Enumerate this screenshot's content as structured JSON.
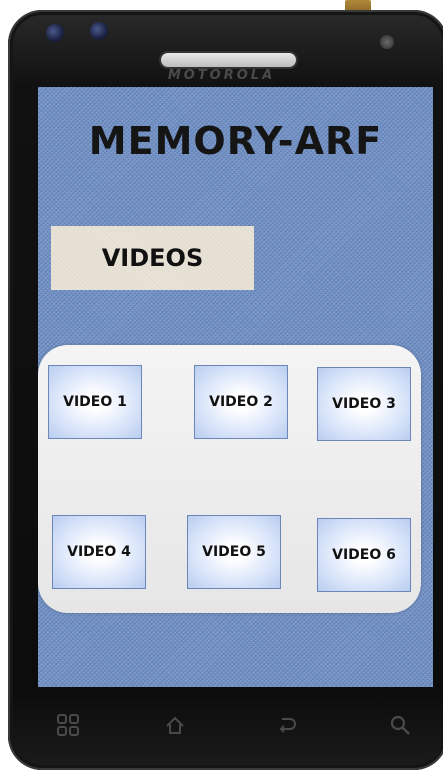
{
  "device": {
    "brand": "MOTOROLA"
  },
  "app": {
    "title": "MEMORY-ARF"
  },
  "section": {
    "label": "VIDEOS"
  },
  "videos": [
    {
      "label": "VIDEO 1"
    },
    {
      "label": "VIDEO 2"
    },
    {
      "label": "VIDEO 3"
    },
    {
      "label": "VIDEO 4"
    },
    {
      "label": "VIDEO 5"
    },
    {
      "label": "VIDEO 6"
    }
  ],
  "navbar": {
    "icons": [
      "menu-grid-icon",
      "home-icon",
      "back-icon",
      "search-icon"
    ]
  },
  "colors": {
    "screen_background": "#6f8fc4",
    "section_background": "#e9e2d6",
    "tile_border": "#6d86b8"
  }
}
